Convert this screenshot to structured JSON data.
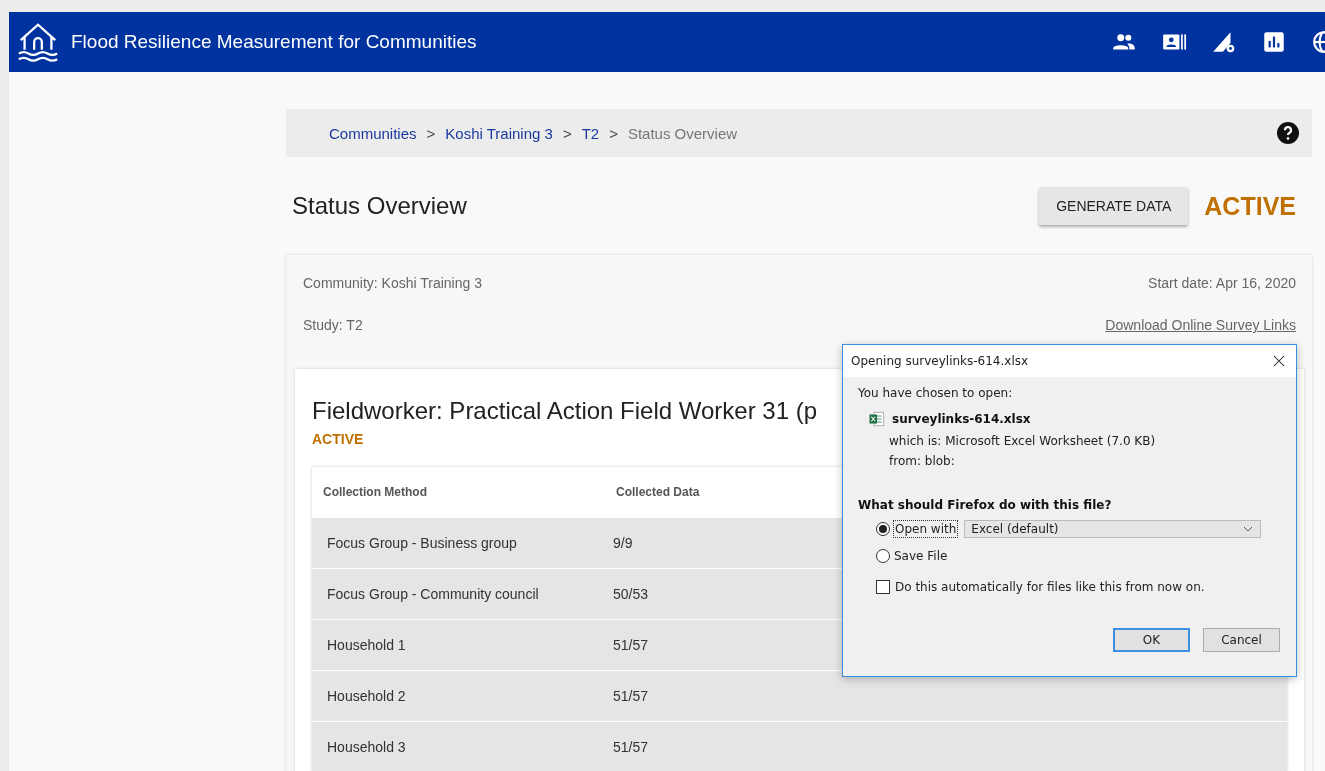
{
  "header": {
    "title": "Flood Resilience Measurement for Communities"
  },
  "breadcrumb": [
    {
      "label": "Communities",
      "kind": "link"
    },
    {
      "separator": ">",
      "label": "Koshi Training 3",
      "kind": "link"
    },
    {
      "separator": ">",
      "label": "T2",
      "kind": "link"
    },
    {
      "separator": ">",
      "label": "Status Overview",
      "kind": "current"
    }
  ],
  "page": {
    "title": "Status Overview",
    "button": "GENERATE DATA",
    "status": "ACTIVE"
  },
  "info": {
    "community": "Community: Koshi Training 3",
    "start_date": "Start date: Apr 16, 2020",
    "study": "Study: T2",
    "download_link": "Download Online Survey Links"
  },
  "fieldworker": {
    "title": "Fieldworker: Practical Action Field Worker 31 (p",
    "status": "ACTIVE"
  },
  "table": {
    "columns": [
      "Collection Method",
      "Collected Data"
    ],
    "rows": [
      [
        "Focus Group - Business group",
        "9/9"
      ],
      [
        "Focus Group - Community council",
        "50/53"
      ],
      [
        "Household 1",
        "51/57"
      ],
      [
        "Household 2",
        "51/57"
      ],
      [
        "Household 3",
        "51/57"
      ]
    ]
  },
  "dialog": {
    "title": "Opening surveylinks-614.xlsx",
    "intro": "You have chosen to open:",
    "file_name": "surveylinks-614.xlsx",
    "file_type": "which is: Microsoft Excel Worksheet (7.0 KB)",
    "source": "from: blob:",
    "question": "What should Firefox do with this file?",
    "options": [
      {
        "label": "Open with",
        "selected": true,
        "app": "Excel (default)"
      },
      {
        "label": "Save File",
        "selected": false
      }
    ],
    "auto": {
      "label": "Do this automatically for files like this from now on.",
      "checked": false
    },
    "buttons": [
      {
        "label": "OK",
        "default": true
      },
      {
        "label": "Cancel",
        "default": false
      }
    ]
  }
}
